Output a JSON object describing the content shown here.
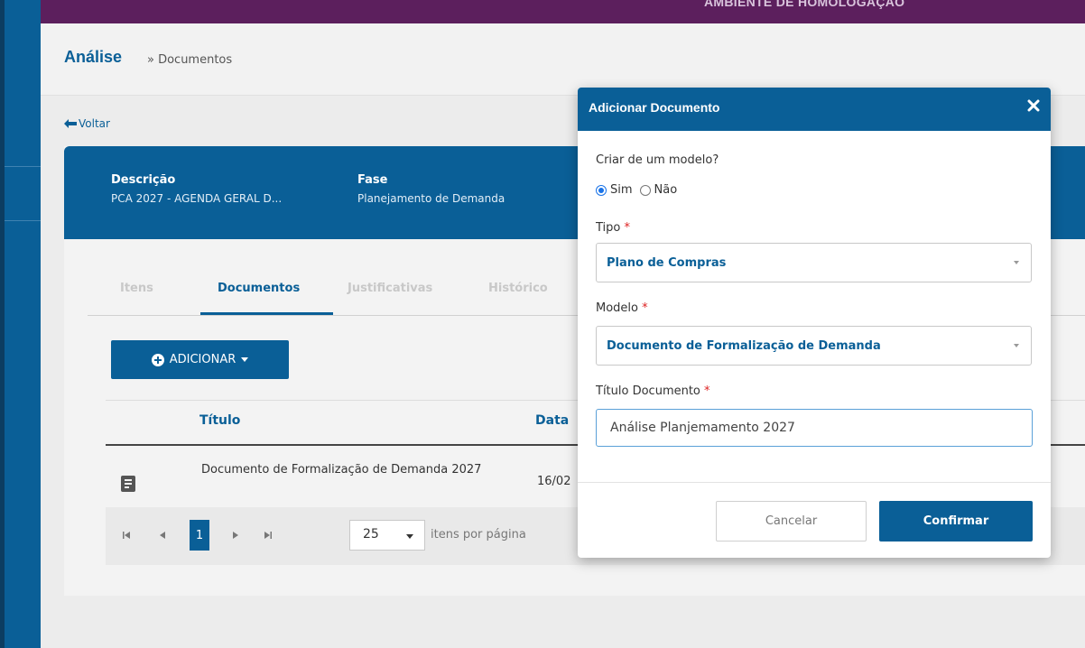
{
  "environment_banner": "AMBIENTE DE HOMOLOGAÇÃO",
  "breadcrumb": {
    "main": "Análise",
    "rest": "» Documentos"
  },
  "back_label": "Voltar",
  "summary": {
    "descricao_label": "Descrição",
    "descricao_value": "PCA 2027 - AGENDA GERAL D...",
    "fase_label": "Fase",
    "fase_value": "Planejamento de Demanda"
  },
  "tabs": [
    {
      "label": "Itens",
      "active": false
    },
    {
      "label": "Documentos",
      "active": true
    },
    {
      "label": "Justificativas",
      "active": false
    },
    {
      "label": "Histórico",
      "active": false
    }
  ],
  "add_button": {
    "label": "ADICIONAR",
    "icon": "plus-circle-icon"
  },
  "table": {
    "columns": [
      "Título",
      "Data"
    ],
    "rows": [
      {
        "icon": "document-icon",
        "title": "Documento de Formalização de Demanda 2027",
        "date": "16/02"
      }
    ]
  },
  "pagination": {
    "current_page": "1",
    "page_size": "25",
    "per_page_label": "itens por página"
  },
  "modal": {
    "title": "Adicionar Documento",
    "criar_modelo_label": "Criar de um modelo?",
    "radio_sim": "Sim",
    "radio_nao": "Não",
    "radio_selected": "Sim",
    "tipo_label": "Tipo",
    "tipo_value": "Plano de Compras",
    "modelo_label": "Modelo",
    "modelo_value": "Documento de Formalização de Demanda",
    "titulo_label": "Título Documento",
    "titulo_value": "Análise Planjemamento 2027",
    "required_marker": "*",
    "cancel_label": "Cancelar",
    "confirm_label": "Confirmar"
  },
  "colors": {
    "primary": "#0a5f97",
    "banner": "#5c1f5d",
    "required": "#dd2222",
    "radio_selected": "#1a73e8"
  }
}
